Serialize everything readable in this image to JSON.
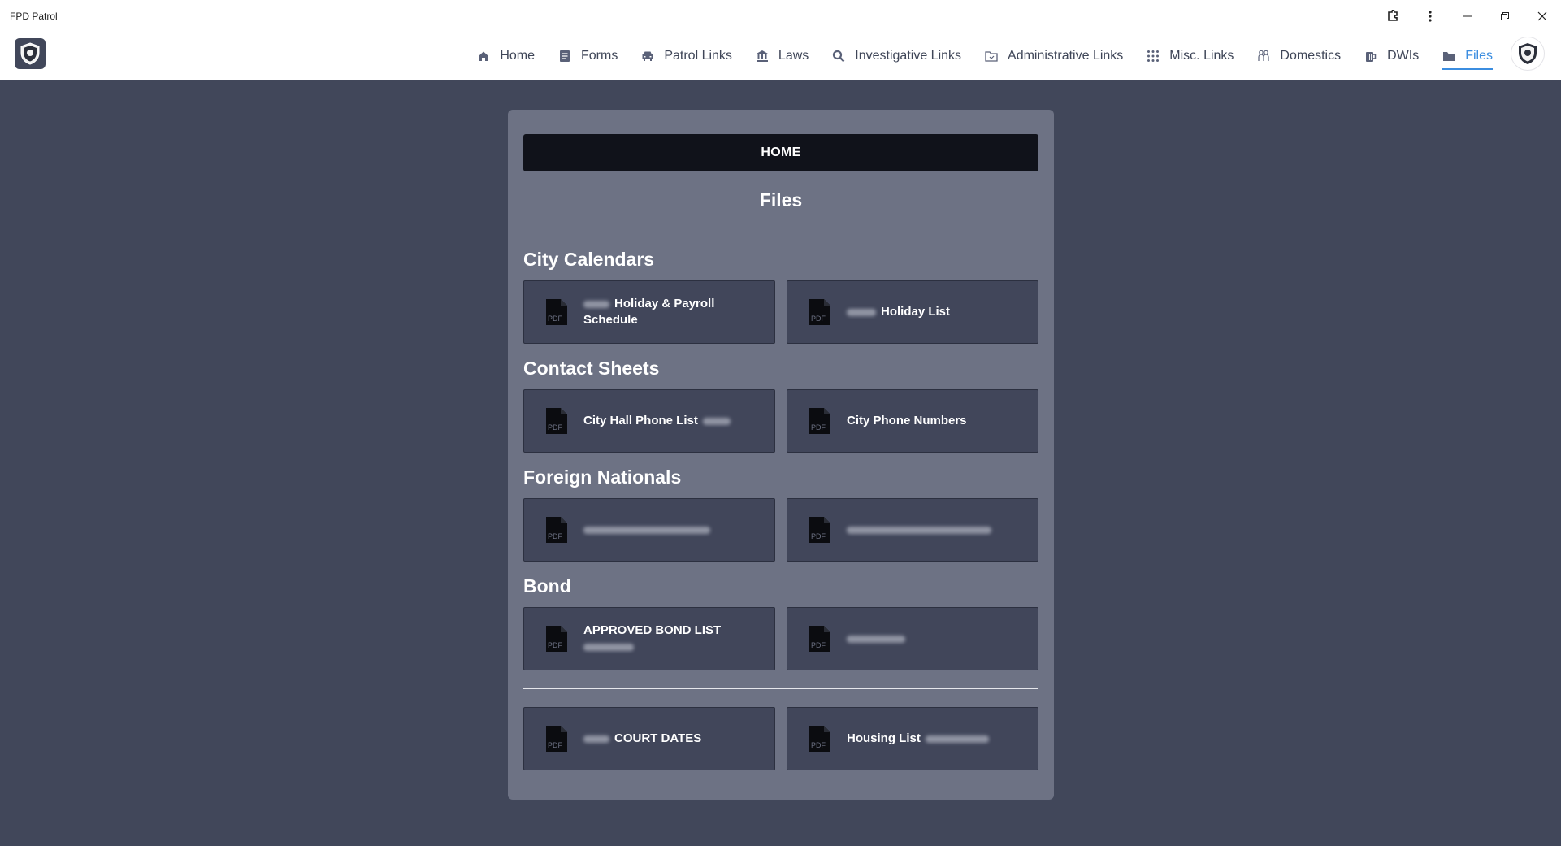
{
  "window": {
    "title": "FPD Patrol"
  },
  "nav": {
    "items": [
      {
        "label": "Home",
        "icon": "home-icon"
      },
      {
        "label": "Forms",
        "icon": "document-icon"
      },
      {
        "label": "Patrol Links",
        "icon": "car-icon"
      },
      {
        "label": "Laws",
        "icon": "courthouse-icon"
      },
      {
        "label": "Investigative Links",
        "icon": "magnifier-icon"
      },
      {
        "label": "Administrative Links",
        "icon": "folder-outline-icon"
      },
      {
        "label": "Misc. Links",
        "icon": "grid-icon"
      },
      {
        "label": "Domestics",
        "icon": "people-icon"
      },
      {
        "label": "DWIs",
        "icon": "beer-mug-icon"
      },
      {
        "label": "Files",
        "icon": "folder-icon",
        "active": true
      }
    ]
  },
  "card": {
    "home_button": "HOME",
    "title": "Files",
    "sections": [
      {
        "title": "City Calendars",
        "files": [
          {
            "label": "Holiday & Payroll Schedule",
            "blur_prefix": true
          },
          {
            "label": "Holiday List",
            "blur_prefix": true
          }
        ]
      },
      {
        "title": "Contact Sheets",
        "files": [
          {
            "label": "City Hall Phone List",
            "blur_suffix": true
          },
          {
            "label": "City Phone Numbers"
          }
        ]
      },
      {
        "title": "Foreign Nationals",
        "files": [
          {
            "label": "",
            "blurred": true
          },
          {
            "label": "",
            "blurred": true
          }
        ]
      },
      {
        "title": "Bond",
        "files": [
          {
            "label": "APPROVED BOND LIST",
            "blur_below": true
          },
          {
            "label": "",
            "blurred": true
          }
        ]
      }
    ],
    "extra_files": [
      {
        "label": "COURT DATES",
        "blur_prefix": true
      },
      {
        "label": "Housing List",
        "blur_suffix": true
      }
    ]
  },
  "colors": {
    "background": "#41475a",
    "card": "#6d7284",
    "tile": "#41465a",
    "active_nav": "#3b8de0",
    "home_button": "#10121a"
  }
}
